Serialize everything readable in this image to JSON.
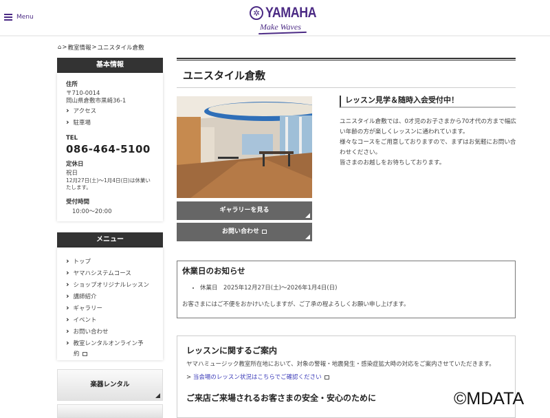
{
  "header": {
    "menu_label": "Menu",
    "logo_word": "YAMAHA",
    "logo_tagline": "Make Waves"
  },
  "breadcrumb": {
    "items": [
      "教室情報",
      "ユニスタイル倉敷"
    ]
  },
  "info": {
    "heading": "基本情報",
    "address_label": "住所",
    "postal": "〒710-0014",
    "address": "岡山県倉敷市黒崎36-1",
    "links": [
      "アクセス",
      "駐車場"
    ],
    "tel_label": "TEL",
    "tel": "086-464-5100",
    "closed_label": "定休日",
    "closed_day": "祝日",
    "closed_note": "12月27日(土)～1月4日(日)は休業いたします。",
    "hours_label": "受付時間",
    "hours": "10:00～20:00"
  },
  "menu": {
    "heading": "メニュー",
    "items": [
      "トップ",
      "ヤマハシステムコース",
      "ショップオリジナルレッスン",
      "講師紹介",
      "ギャラリー",
      "イベント",
      "お問い合わせ",
      "教室レンタルオンライン予約"
    ]
  },
  "rental_label": "楽器レンタル",
  "main": {
    "title": "ユニスタイル倉敷",
    "gallery_button": "ギャラリーを見る",
    "contact_button": "お問い合わせ",
    "promo_heading": "レッスン見学＆随時入会受付中！",
    "promo_lines": [
      "ユニスタイル倉敷では、0才児のお子さまから70才代の方まで幅広い年齢の方が楽しくレッスンに通われています。",
      "様々なコースをご用意しておりますので、まずはお気軽にお問い合わせください。",
      "皆さまのお越しをお待ちしております。"
    ]
  },
  "notice": {
    "heading": "休業日のお知らせ",
    "item": "休業日　2025年12月27日(土)～2026年1月4日(日)",
    "text": "お客さまにはご不便をおかけいたしますが、ご了承の程よろしくお願い申し上げます。"
  },
  "lesson": {
    "heading": "レッスンに関するご案内",
    "text": "ヤマハミュージック教室所在地において、対象の警報・地震発生・感染症拡大時の対応をご案内させていただきます。",
    "link": "当会場のレッスン状況はこちらでご確認ください",
    "heading2": "ご来店ご来場されるお客さまの安全・安心のために"
  },
  "watermark": "©MDATA"
}
